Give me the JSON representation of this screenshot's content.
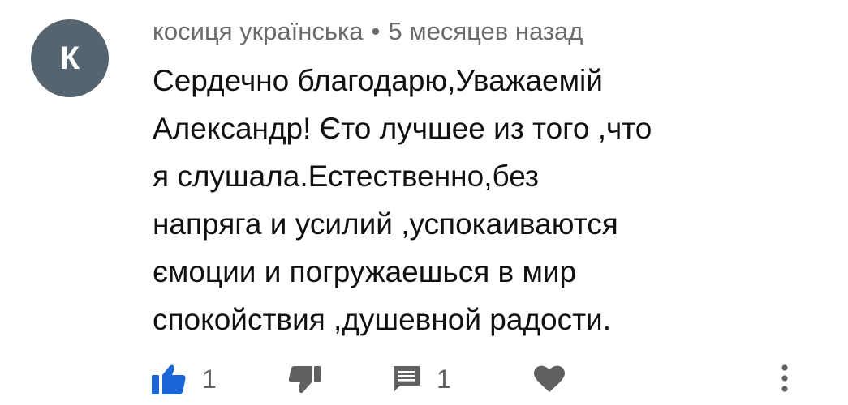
{
  "comment": {
    "avatar_letter": "К",
    "author": "косиця українська",
    "separator": "•",
    "timestamp": "5 месяцев назад",
    "lines": [
      "Сердечно благодарю,Уважаемій",
      "Александр! Єто лучшее из того ,что",
      "я слушала.Естественно,без",
      "напряга и усилий ,успокаиваются",
      "ємоции и погружаешься в мир",
      "спокойствия ,душевной радости."
    ],
    "like_count": "1",
    "reply_count": "1"
  },
  "colors": {
    "avatar_bg": "#56646f",
    "like_active": "#1a65d6",
    "icon_gray": "#606060",
    "meta_text": "#6b6b6b"
  },
  "icons": {
    "like": "thumbs-up-icon",
    "dislike": "thumbs-down-icon",
    "reply": "comment-icon",
    "heart": "heart-icon",
    "more": "more-vertical-icon"
  }
}
